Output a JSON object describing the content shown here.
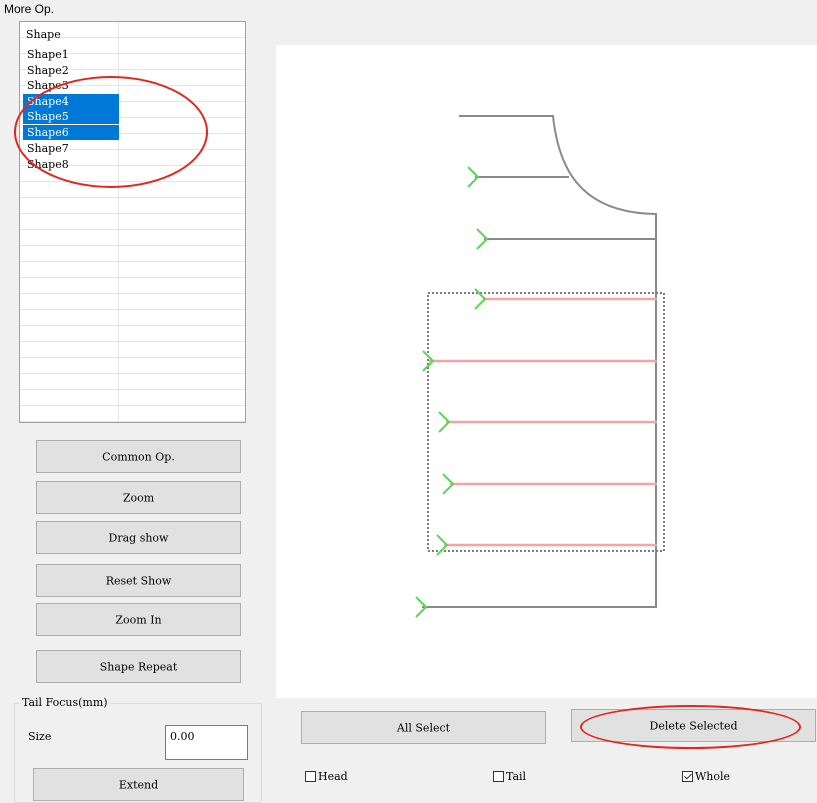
{
  "window": {
    "title": "More Op."
  },
  "shape_list": {
    "header": "Shape",
    "items": [
      {
        "label": "Shape1",
        "selected": false
      },
      {
        "label": "Shape2",
        "selected": false
      },
      {
        "label": "Shape3",
        "selected": false
      },
      {
        "label": "Shape4",
        "selected": true
      },
      {
        "label": "Shape5",
        "selected": true
      },
      {
        "label": "Shape6",
        "selected": true
      },
      {
        "label": "Shape7",
        "selected": false
      },
      {
        "label": "Shape8",
        "selected": false
      }
    ]
  },
  "buttons": {
    "common_op": "Common Op.",
    "zoom": "Zoom",
    "drag_show": "Drag show",
    "reset_show": "Reset Show",
    "zoom_in": "Zoom In",
    "shape_repeat": "Shape Repeat",
    "extend": "Extend",
    "all_select": "All Select",
    "delete_selected": "Delete Selected"
  },
  "tail_focus": {
    "label": "Tail Focus(mm)",
    "size_label": "Size",
    "size_value": "0.00"
  },
  "checkboxes": {
    "head": {
      "label": "Head",
      "checked": false
    },
    "tail": {
      "label": "Tail",
      "checked": false
    },
    "whole": {
      "label": "Whole",
      "checked": true
    }
  },
  "colors": {
    "selection": "#0078d7",
    "selected_shape": "#f4a3a8",
    "unselected_shape": "#808080",
    "marker": "#5ad65a",
    "annotation": "#e0281e"
  }
}
